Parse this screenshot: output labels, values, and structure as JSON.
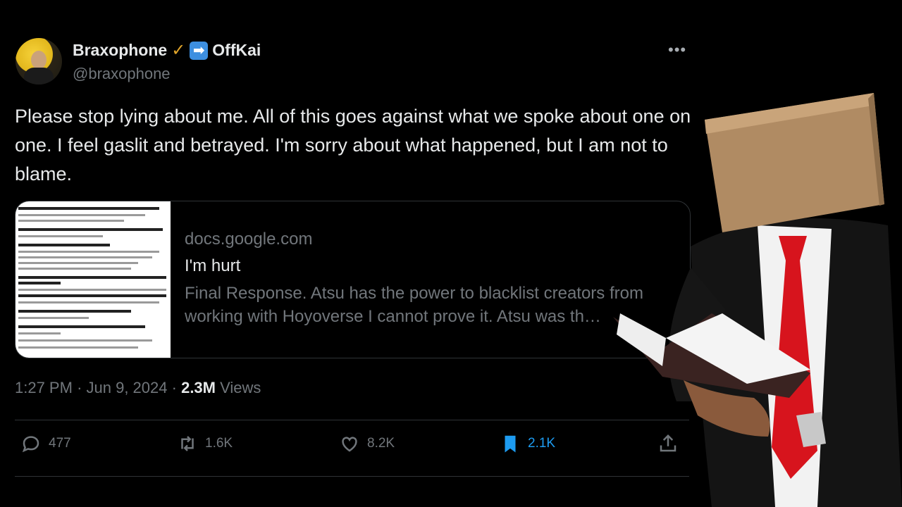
{
  "author": {
    "name": "Braxophone",
    "verified_mark": "✓",
    "arrow_badge": "➡",
    "affiliate": "OffKai",
    "handle": "@braxophone"
  },
  "more_label": "•••",
  "tweet": {
    "text": "Please stop lying about me. All of this goes against what we spoke about one on one. I feel gaslit and betrayed. I'm sorry about what happened, but I am not to blame."
  },
  "link_card": {
    "domain": "docs.google.com",
    "title": "I'm hurt",
    "description": "Final Response. Atsu has the power to blacklist creators from working with Hoyoverse I cannot prove it. Atsu was th…"
  },
  "meta": {
    "time": "1:27 PM",
    "separator": "·",
    "date": "Jun 9, 2024",
    "views_count": "2.3M",
    "views_label": "Views"
  },
  "actions": {
    "replies": "477",
    "reposts": "1.6K",
    "likes": "8.2K",
    "bookmarks": "2.1K"
  },
  "colors": {
    "background": "#000000",
    "text": "#e7e9ea",
    "muted": "#71767b",
    "bookmark_active": "#1d9bf0",
    "gold_check": "#e0a42a",
    "divider": "#2f3336"
  },
  "icons": [
    "reply-icon",
    "repost-icon",
    "like-icon",
    "bookmark-icon",
    "share-icon",
    "more-icon"
  ]
}
